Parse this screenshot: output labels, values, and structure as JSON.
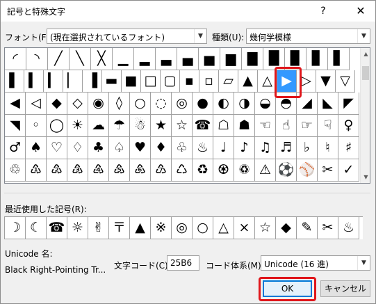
{
  "window": {
    "title": "記号と特殊文字",
    "help_glyph": "?",
    "close_glyph": "✕"
  },
  "font": {
    "label": "フォント(F):",
    "value": "(現在選択されているフォント)"
  },
  "subset": {
    "label": "種類(U):",
    "value": "幾何学模様"
  },
  "symbol_grid": {
    "rows": [
      [
        "◜",
        "◝",
        "╱",
        "╲",
        "╳",
        "▁",
        "▂",
        "▃",
        "▄",
        "▅",
        "▆",
        "▇",
        "█",
        "▉",
        "▊",
        "▋"
      ],
      [
        "▌",
        "▍",
        "▎",
        "▏",
        "▐",
        "▬",
        "■",
        "□",
        "▢",
        "▪",
        "▫",
        "▱",
        "▲",
        "△",
        "▶",
        "▷",
        "▼",
        "▽"
      ],
      [
        "◀",
        "◁",
        "◆",
        "◇",
        "◉",
        "◊",
        "○",
        "◌",
        "◎",
        "●",
        "◐",
        "◑",
        "◒",
        "◓",
        "◢",
        "◣",
        "◤"
      ],
      [
        "◥",
        "◦",
        "◯",
        "☀",
        "☁",
        "☂",
        "☃",
        "★",
        "☆",
        "☎",
        "☖",
        "☗",
        "☜",
        "☝",
        "☞",
        "☟",
        "♀"
      ],
      [
        "♂",
        "♠",
        "♡",
        "♢",
        "♣",
        "♤",
        "♥",
        "♦",
        "♧",
        "♨",
        "♩",
        "♪",
        "♫",
        "♬",
        "♭",
        "♮",
        "♯"
      ],
      [
        "♲",
        "♳",
        "♴",
        "♵",
        "♶",
        "♷",
        "♸",
        "♹",
        "♺",
        "♻",
        "♼",
        "♽",
        "⚠",
        "⚽",
        "⚾",
        "✂",
        "✓"
      ]
    ],
    "selected": "▶"
  },
  "recent": {
    "label": "最近使用した記号(R):",
    "symbols": [
      "☽",
      "☾",
      "☎",
      "☼",
      "✌",
      "〒",
      "▲",
      "※",
      "◎",
      "○",
      "△",
      "×",
      "☆",
      "◆",
      "✎",
      "✂",
      "♨"
    ]
  },
  "unicode_name": {
    "label": "Unicode 名:",
    "value": "Black Right-Pointing Tr..."
  },
  "char_code": {
    "label": "文字コード(C):",
    "value": "25B6"
  },
  "from": {
    "label": "コード体系(M):",
    "value": "Unicode (16 進)"
  },
  "buttons": {
    "ok": "OK",
    "cancel": "キャンセル"
  },
  "colors": {
    "selection": "#3399ff",
    "highlight": "#e0161b",
    "default_button_border": "#0078d7"
  }
}
